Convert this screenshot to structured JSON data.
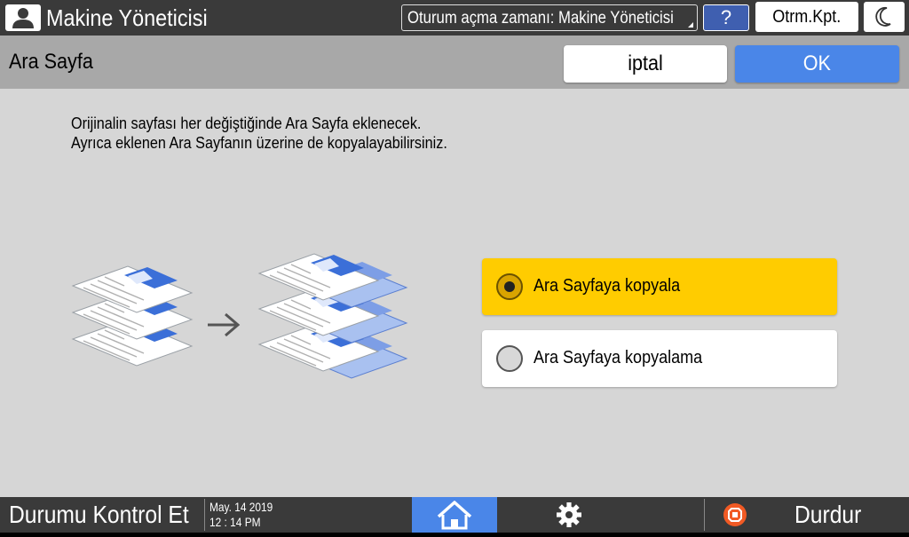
{
  "topbar": {
    "user_name": "Makine Yöneticisi",
    "login_time_label": "Oturum açma zamanı: Makine Yöneticisi",
    "help_label": "?",
    "logout_label": "Otrm.Kpt."
  },
  "header": {
    "title": "Ara Sayfa",
    "cancel_label": "iptal",
    "ok_label": "OK"
  },
  "main": {
    "description_line1": "Orijinalin sayfası her değiştiğinde Ara Sayfa eklenecek.",
    "description_line2": "Ayrıca eklenen Ara Sayfanın üzerine de kopyalayabilirsiniz.",
    "options": [
      {
        "label": "Ara Sayfaya kopyala",
        "selected": true
      },
      {
        "label": "Ara Sayfaya kopyalama",
        "selected": false
      }
    ]
  },
  "footer": {
    "status_label": "Durumu Kontrol Et",
    "date": "May. 14 2019",
    "time": "12 : 14 PM",
    "stop_label": "Durdur"
  },
  "colors": {
    "accent_blue": "#4a86e8",
    "selected_yellow": "#ffcc00",
    "bar_dark": "#3a3a3a"
  },
  "icons": [
    "user-icon",
    "moon-icon",
    "home-icon",
    "gear-icon",
    "stop-icon",
    "arrow-right-icon",
    "dropdown-triangle-icon"
  ]
}
